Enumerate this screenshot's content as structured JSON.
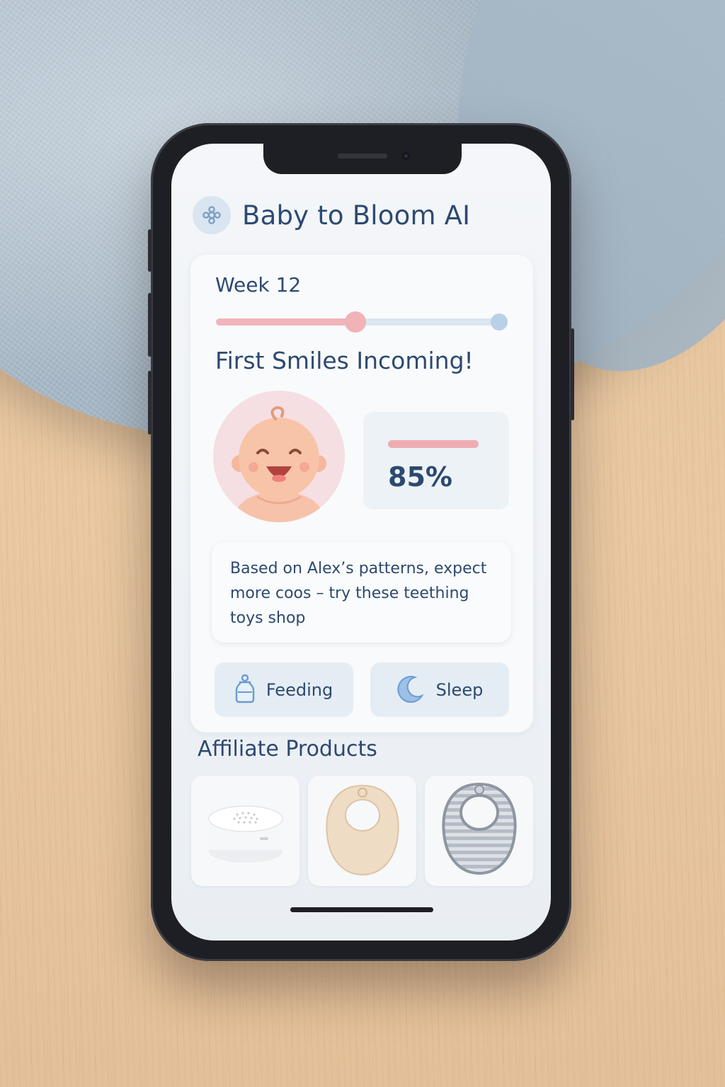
{
  "app": {
    "title": "Baby to Bloom AI",
    "logo_icon": "flower-logo-icon"
  },
  "week_card": {
    "week_label": "Week 12",
    "timeline_progress": 0.48,
    "milestone_title": "First Smiles Incoming!",
    "baby_icon": "smiling-baby-icon",
    "progress_percent_label": "85%",
    "progress_value": 0.85,
    "insight_text": "Based on Alex’s patterns, expect more coos – try these teething toys  shop",
    "buttons": [
      {
        "label": "Feeding",
        "icon": "baby-bottle-icon"
      },
      {
        "label": "Sleep",
        "icon": "crescent-moon-icon"
      }
    ]
  },
  "affiliate": {
    "title": "Affiliate Products",
    "products": [
      {
        "icon": "white-noise-machine-icon"
      },
      {
        "icon": "beige-bib-icon"
      },
      {
        "icon": "striped-bib-icon"
      }
    ]
  },
  "colors": {
    "text_primary": "#2d4970",
    "accent_pink": "#efb3b8",
    "accent_blue": "#b9d0e8"
  }
}
